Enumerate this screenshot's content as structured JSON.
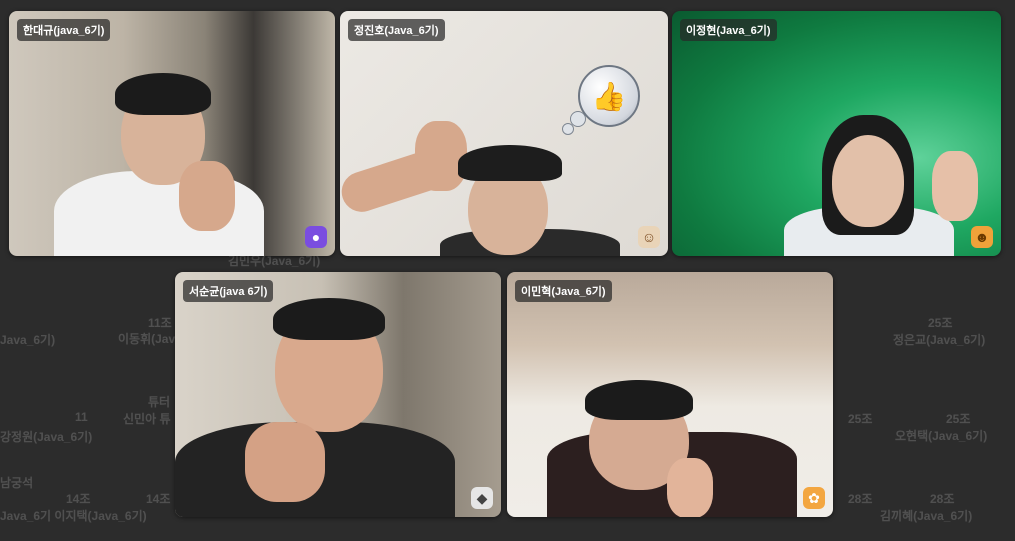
{
  "tiles": [
    {
      "name": "한대규(java_6기)",
      "avatar_icon": "purple-robot-icon",
      "avatar_color": "#7a4de0"
    },
    {
      "name": "정진호(Java_6기)",
      "avatar_icon": "brown-hair-character-icon",
      "avatar_color": "#e9d4b8"
    },
    {
      "name": "이정현(Java_6기)",
      "avatar_icon": "hat-character-icon",
      "avatar_color": "#f0a23a"
    },
    {
      "name": "서순균(java 6기)",
      "avatar_icon": "white-robot-icon",
      "avatar_color": "#e6e6e6"
    },
    {
      "name": "이민혁(Java_6기)",
      "avatar_icon": "white-bunny-icon",
      "avatar_color": "#f3a640"
    }
  ],
  "reaction": {
    "icon": "thumbs-up-icon",
    "glyph": "👍"
  },
  "background_labels": [
    "김민우(Java_6기)",
    "이동휘(Java_6기)",
    "11조",
    "튜터",
    "신민아 튜",
    "11",
    "Java_6기)",
    "남궁석",
    "강정원(Java_6기)",
    "14조",
    "14조",
    "Java_6기 이지택(Java_6기)",
    "25조",
    "정은교(Java_6기)",
    "25조",
    "25조",
    "오현택(Java_6기)",
    "28조",
    "28조",
    "김끼혜(Java_6기)"
  ]
}
